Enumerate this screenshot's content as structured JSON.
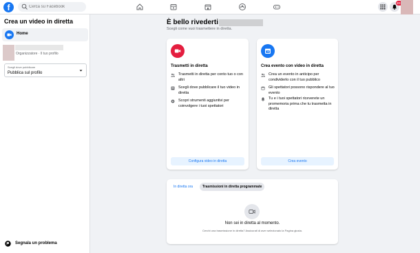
{
  "topbar": {
    "logo": "f",
    "search_placeholder": "Cerca su Facebook",
    "notification_count": "20+",
    "nav_icons": [
      "home-icon",
      "pages-icon",
      "marketplace-icon",
      "groups-icon",
      "gaming-icon"
    ]
  },
  "sidebar": {
    "title": "Crea un video in diretta",
    "home_label": "Home",
    "profile_role": "Organizzatore · Il tuo profilo",
    "select_label": "Scegli dove pubblicare",
    "select_value": "Pubblica sul profilo",
    "report_label": "Segnala un problema"
  },
  "main": {
    "greeting": "È bello rivederti",
    "subtitle": "Scegli come vuoi trasmettere in diretta.",
    "cards": [
      {
        "title": "Trasmetti in diretta",
        "icon": "video-camera-icon",
        "color": "#e41e3f",
        "features": [
          "Trasmetti in diretta per conto tuo o con altri",
          "Scegli dove pubblicare il tuo video in diretta",
          "Scopri strumenti aggiuntivi per coinvolgere i tuoi spettatori"
        ],
        "button": "Configura video in diretta"
      },
      {
        "title": "Crea evento con video in diretta",
        "icon": "calendar-icon",
        "color": "#1877f2",
        "features": [
          "Crea un evento in anticipo per condividerlo con il tuo pubblico",
          "Gli spettatori possono rispondere al tuo evento",
          "Tu e i tuoi spettatori riceverete un promemoria prima che tu trasmetta in diretta"
        ],
        "button": "Crea evento"
      }
    ],
    "tabs": [
      "In diretta ora",
      "Trasmissioni in diretta programmate"
    ],
    "empty_title": "Non sei in diretta al momento.",
    "empty_desc": "Cerchi una trasmissione in diretta? Assicurati di aver selezionato la Pagina giusta."
  }
}
